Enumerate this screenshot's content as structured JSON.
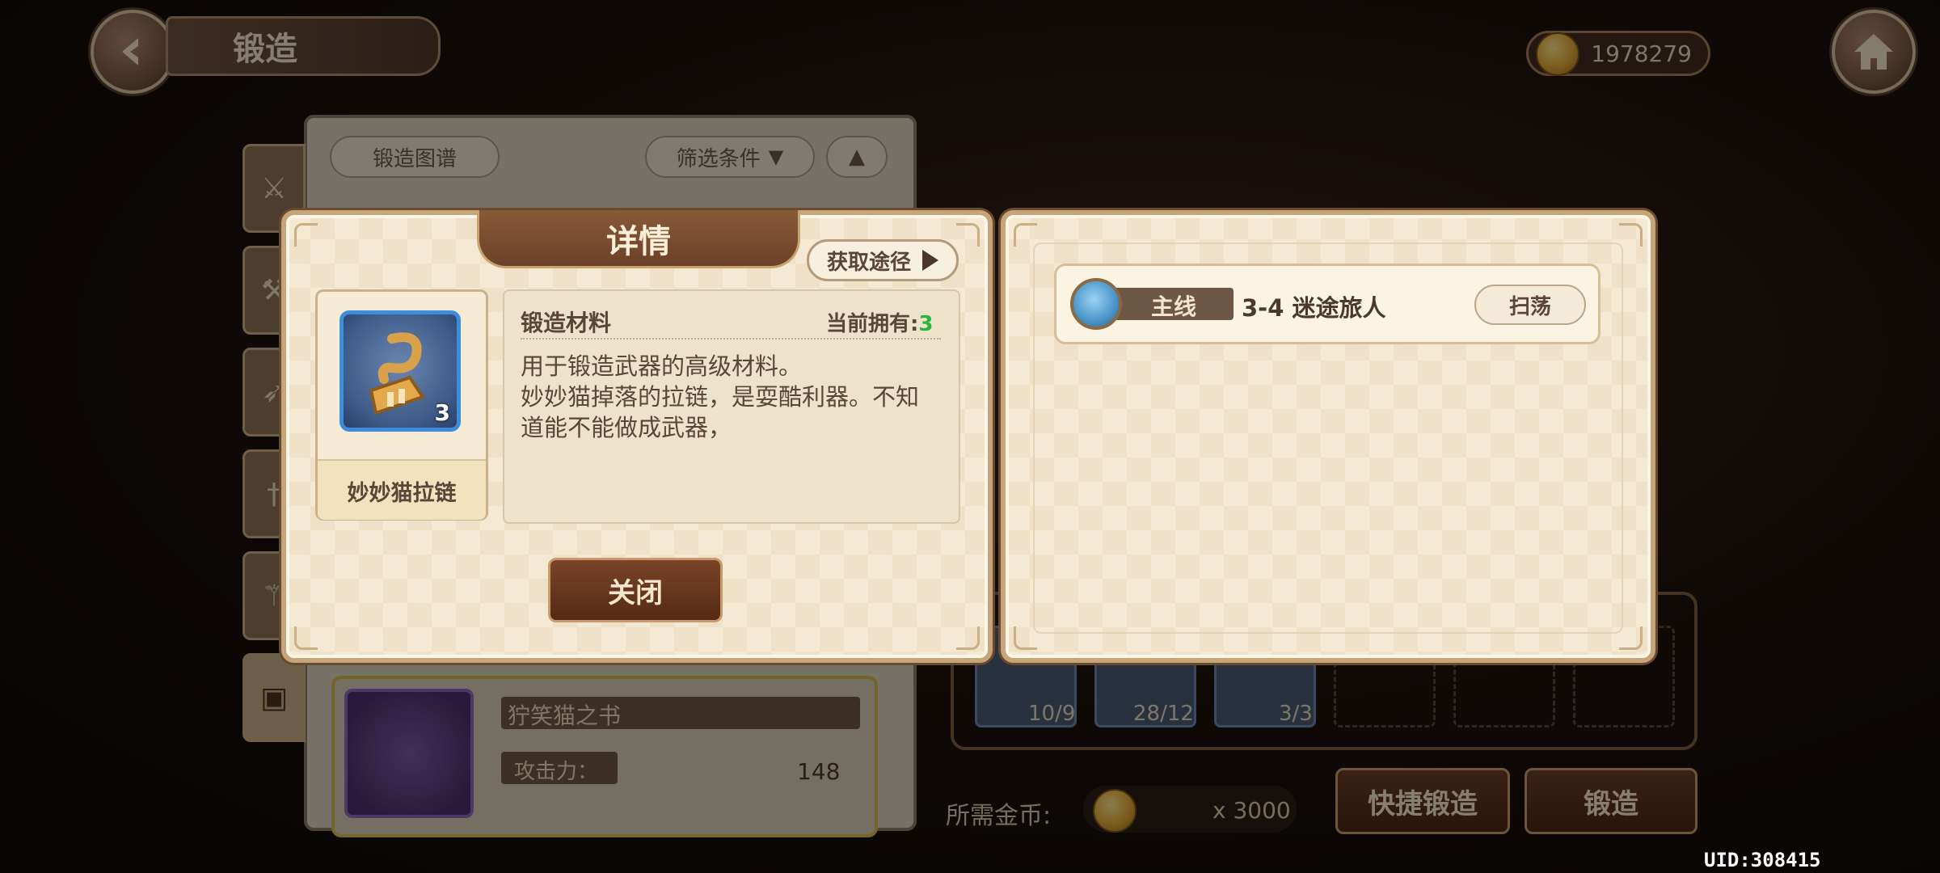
{
  "header": {
    "title": "锻造",
    "gold": "1978279"
  },
  "forge": {
    "recipe_button": "锻造图谱",
    "filter_button": "筛选条件",
    "item": {
      "name": "狞笑猫之书",
      "stat_label": "攻击力：",
      "stat_value": "148"
    },
    "materials": [
      {
        "count": "10/9"
      },
      {
        "count": "28/12"
      },
      {
        "count": "3/3"
      }
    ],
    "cost_label": "所需金币:",
    "cost_value": "x 3000",
    "quick_forge_button": "快捷锻造",
    "forge_button": "锻造"
  },
  "detail_modal": {
    "title": "详情",
    "source_button": "获取途径",
    "item_name": "妙妙猫拉链",
    "item_count": "3",
    "category": "锻造材料",
    "owned_label": "当前拥有:",
    "owned_value": "3",
    "description": "用于锻造武器的高级材料。\n妙妙猫掉落的拉链，是耍酷利器。不知道能不能做成武器，",
    "close_button": "关闭"
  },
  "source_modal": {
    "entries": [
      {
        "tag": "主线",
        "stage": "3-4 迷途旅人",
        "action": "扫荡"
      }
    ]
  },
  "footer": {
    "uid": "UID:308415"
  },
  "colors": {
    "owned_value": "#2bb53a",
    "accent_brown": "#6b4128",
    "frame": "#c7a57a"
  }
}
